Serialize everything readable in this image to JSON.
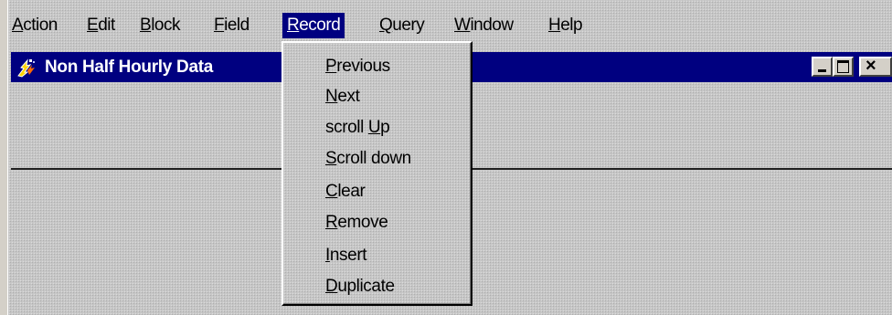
{
  "menubar": {
    "items": [
      {
        "label": "Action",
        "ul": "A",
        "rest": "ction"
      },
      {
        "label": "Edit",
        "ul": "E",
        "rest": "dit"
      },
      {
        "label": "Block",
        "ul": "B",
        "rest": "lock"
      },
      {
        "label": "Field",
        "ul": "F",
        "rest": "ield"
      },
      {
        "label": "Record",
        "ul": "R",
        "rest": "ecord",
        "active": true
      },
      {
        "label": "Query",
        "ul": "Q",
        "rest": "uery"
      },
      {
        "label": "Window",
        "ul": "W",
        "rest": "indow"
      },
      {
        "label": "Help",
        "ul": "H",
        "rest": "elp"
      }
    ]
  },
  "window": {
    "title": "Non Half Hourly Data",
    "icon": "app-flame-icon",
    "buttons": {
      "minimize": "minimize-icon",
      "maximize": "maximize-icon",
      "close": "close-icon"
    },
    "close_glyph": "×"
  },
  "record_menu": {
    "items": [
      {
        "label": "Previous",
        "pre": "",
        "ul": "P",
        "rest": "revious"
      },
      {
        "label": "Next",
        "pre": "",
        "ul": "N",
        "rest": "ext"
      },
      {
        "label": "scroll Up",
        "pre": "scroll ",
        "ul": "U",
        "rest": "p"
      },
      {
        "label": "Scroll down",
        "pre": "",
        "ul": "S",
        "rest": "croll down"
      },
      {
        "label": "Clear",
        "pre": "",
        "ul": "C",
        "rest": "lear"
      },
      {
        "label": "Remove",
        "pre": "",
        "ul": "R",
        "rest": "emove"
      },
      {
        "label": "Insert",
        "pre": "",
        "ul": "I",
        "rest": "nsert"
      },
      {
        "label": "Duplicate",
        "pre": "",
        "ul": "D",
        "rest": "uplicate"
      }
    ]
  },
  "colors": {
    "titlebar": "#000080",
    "menu_highlight": "#000080",
    "face": "#c7c7c7"
  }
}
